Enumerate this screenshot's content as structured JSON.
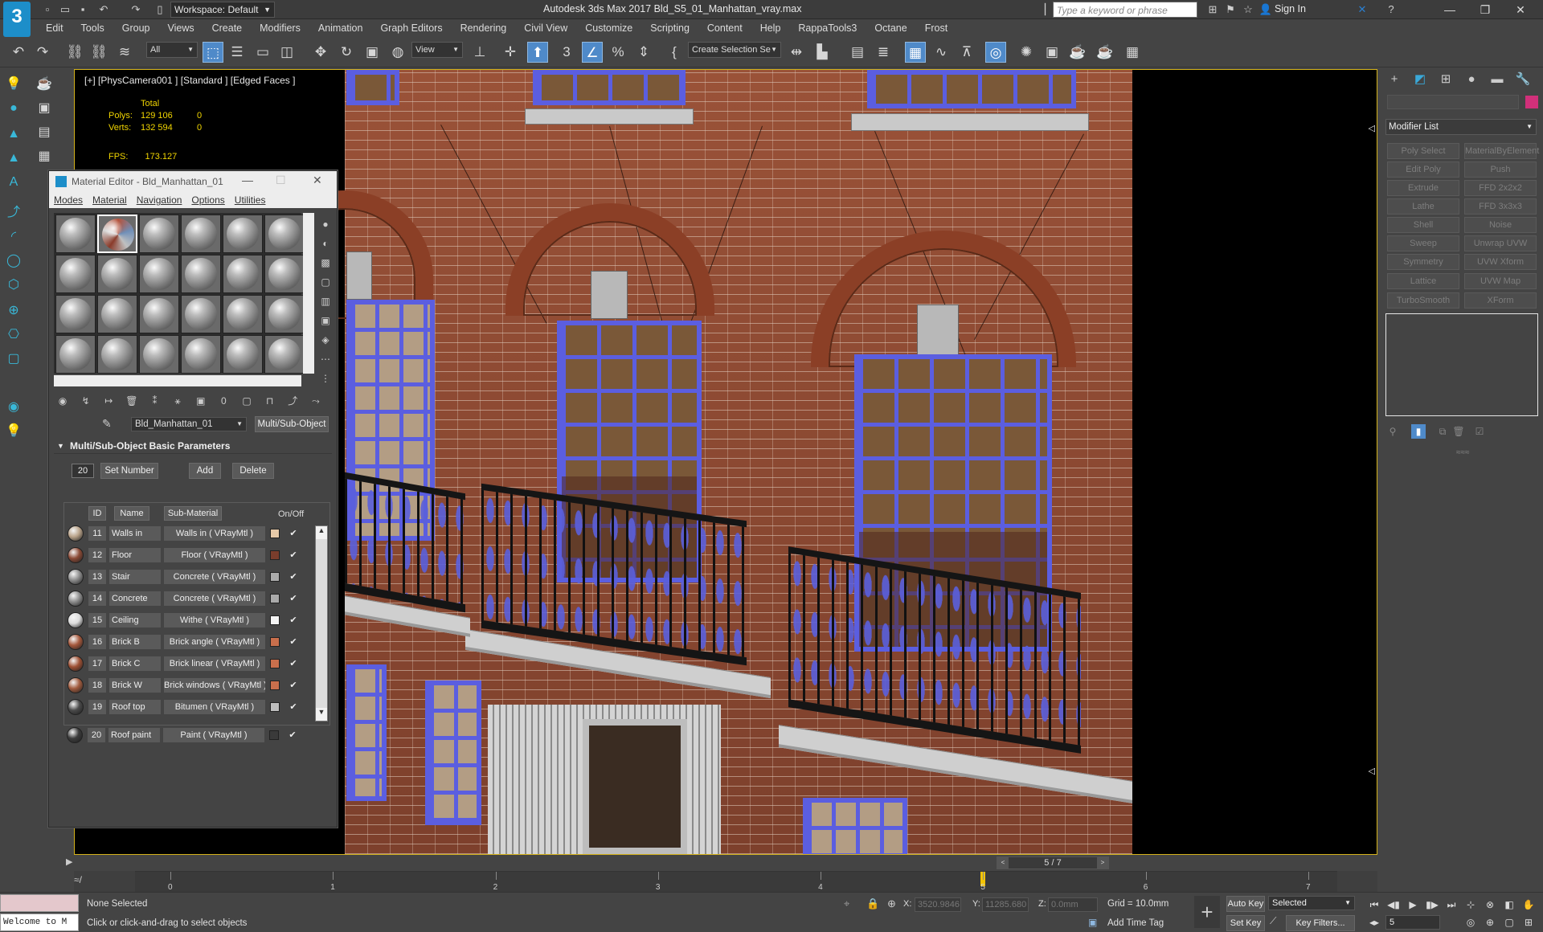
{
  "app": {
    "logo": "3",
    "title": "Autodesk 3ds Max 2017     Bld_S5_01_Manhattan_vray.max",
    "workspace": "Workspace: Default",
    "search_placeholder": "Type a keyword or phrase",
    "sign_in": "Sign In"
  },
  "menu": [
    "Edit",
    "Tools",
    "Group",
    "Views",
    "Create",
    "Modifiers",
    "Animation",
    "Graph Editors",
    "Rendering",
    "Civil View",
    "Customize",
    "Scripting",
    "Content",
    "Help",
    "RappaTools3",
    "Octane",
    "Frost"
  ],
  "toolbar": {
    "selection_filter": "All",
    "ref_coord": "View",
    "named_selection": "Create Selection Se"
  },
  "viewport": {
    "label": "[+] [PhysCamera001 ] [Standard ] [Edged Faces ]",
    "stats": {
      "header": "Total",
      "polys_label": "Polys:",
      "polys_total": "129 106",
      "polys_sel": "0",
      "verts_label": "Verts:",
      "verts_total": "132 594",
      "verts_sel": "0",
      "fps_label": "FPS:",
      "fps_value": "173.127"
    }
  },
  "material_editor": {
    "title": "Material Editor - Bld_Manhattan_01",
    "menus": [
      "Modes",
      "Material",
      "Navigation",
      "Options",
      "Utilities"
    ],
    "material_name": "Bld_Manhattan_01",
    "material_type": "Multi/Sub-Object",
    "rollout_title": "Multi/Sub-Object Basic Parameters",
    "num_materials": "20",
    "set_number_label": "Set Number",
    "add_label": "Add",
    "delete_label": "Delete",
    "col_id": "ID",
    "col_name": "Name",
    "col_submat": "Sub-Material",
    "col_onoff": "On/Off",
    "rows": [
      {
        "id": "11",
        "name": "Walls in",
        "submat": "Walls in  ( VRayMtl )",
        "swatch": "#e6c9a8",
        "thumb": "#b9a38a"
      },
      {
        "id": "12",
        "name": "Floor",
        "submat": "Floor  ( VRayMtl )",
        "swatch": "#7a3d2c",
        "thumb": "#8b4a36"
      },
      {
        "id": "13",
        "name": "Stair",
        "submat": "Concrete  ( VRayMtl )",
        "swatch": "#aaaaaa",
        "thumb": "#8d8d8d"
      },
      {
        "id": "14",
        "name": "Concrete",
        "submat": "Concrete  ( VRayMtl )",
        "swatch": "#aaaaaa",
        "thumb": "#8d8d8d"
      },
      {
        "id": "15",
        "name": "Ceiling",
        "submat": "Withe  ( VRayMtl )",
        "swatch": "#f4f4f4",
        "thumb": "#dcdcdc"
      },
      {
        "id": "16",
        "name": "Brick B",
        "submat": "Brick angle  ( VRayMtl )",
        "swatch": "#c96f4c",
        "thumb": "#a5583c"
      },
      {
        "id": "17",
        "name": "Brick C",
        "submat": "Brick linear  ( VRayMtl )",
        "swatch": "#c96f4c",
        "thumb": "#9e5034"
      },
      {
        "id": "18",
        "name": "Brick W",
        "submat": "Brick windows  ( VRayMtl )",
        "swatch": "#c96f4c",
        "thumb": "#a15b3e"
      },
      {
        "id": "19",
        "name": "Roof top",
        "submat": "Bitumen  ( VRayMtl )",
        "swatch": "#bdbdbd",
        "thumb": "#4a4a4a"
      },
      {
        "id": "20",
        "name": "Roof paint",
        "submat": "Paint  ( VRayMtl )",
        "swatch": "#3a3a3a",
        "thumb": "#3c3c3c"
      }
    ]
  },
  "command_panel": {
    "modifier_list": "Modifier List",
    "modifiers": [
      "Poly Select",
      "MaterialByElement",
      "Edit Poly",
      "Push",
      "Extrude",
      "FFD 2x2x2",
      "Lathe",
      "FFD 3x3x3",
      "Shell",
      "Noise",
      "Sweep",
      "Unwrap UVW",
      "Symmetry",
      "UVW Xform",
      "Lattice",
      "UVW Map",
      "TurboSmooth",
      "XForm"
    ],
    "object_color": "#d1307a"
  },
  "timeline": {
    "frame_display": "5 / 7",
    "ticks": [
      "0",
      "1",
      "2",
      "3",
      "4",
      "5",
      "6",
      "7"
    ],
    "current_frame": 5,
    "total_frames": 7
  },
  "status": {
    "maxscript": "Welcome to M",
    "selection": "None Selected",
    "prompt": "Click or click-and-drag to select objects",
    "x_label": "X:",
    "x_value": "3520.9846",
    "y_label": "Y:",
    "y_value": "11285.680",
    "z_label": "Z:",
    "z_value": "0.0mm",
    "grid": "Grid = 10.0mm",
    "add_time_tag": "Add Time Tag",
    "auto_key": "Auto Key",
    "set_key": "Set Key",
    "key_mode": "Selected",
    "key_filters": "Key Filters...",
    "frame_input": "5"
  }
}
